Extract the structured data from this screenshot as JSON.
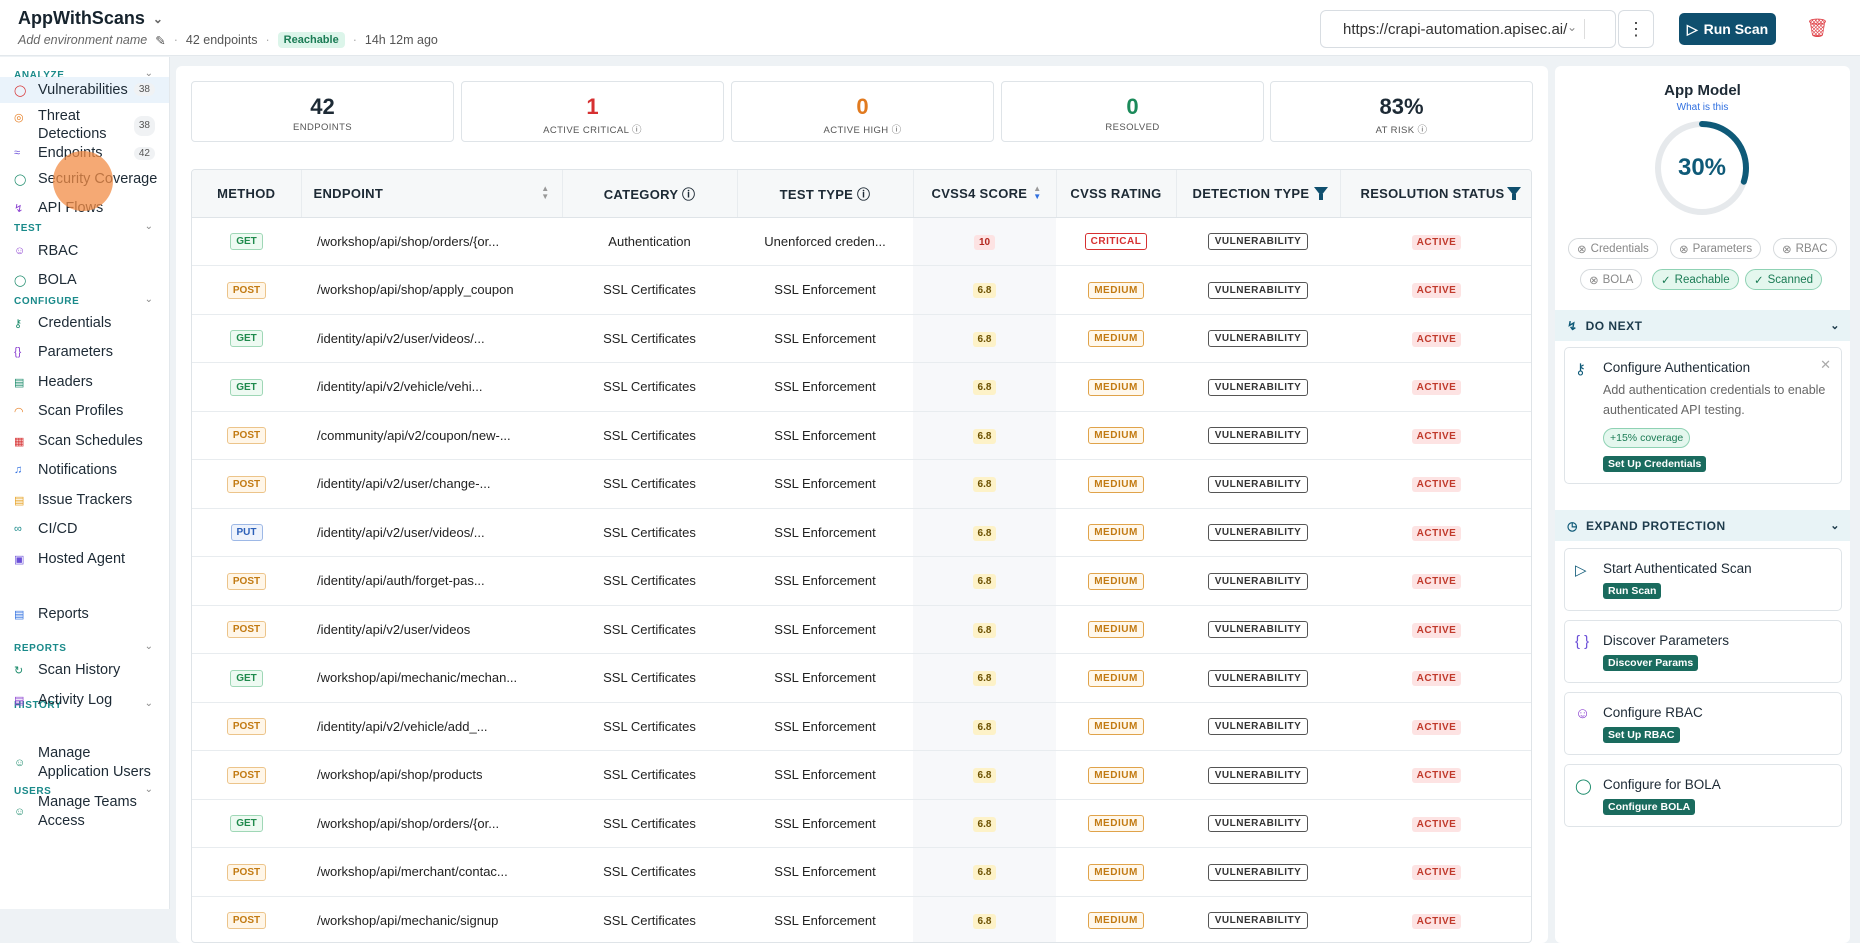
{
  "header": {
    "app_name": "AppWithScans",
    "env_placeholder": "Add environment name",
    "endpoints_count": "42 endpoints",
    "status_badge": "Reachable",
    "last_scan": "14h 12m ago",
    "url": "https://crapi-automation.apisec.ai/",
    "run_scan_label": "Run Scan"
  },
  "sidebar": {
    "sections": [
      {
        "title": "ANALYZE"
      },
      {
        "title": "TEST"
      },
      {
        "title": "CONFIGURE"
      },
      {
        "title": "REPORTS"
      },
      {
        "title": "HISTORY"
      },
      {
        "title": "USERS"
      }
    ],
    "items": [
      {
        "label": "Vulnerabilities",
        "count": "38"
      },
      {
        "label": "Threat Detections",
        "count": "38"
      },
      {
        "label": "Endpoints",
        "count": "42"
      },
      {
        "label": "Security Coverage"
      },
      {
        "label": "API Flows"
      },
      {
        "label": "RBAC"
      },
      {
        "label": "BOLA"
      },
      {
        "label": "Credentials"
      },
      {
        "label": "Parameters"
      },
      {
        "label": "Headers"
      },
      {
        "label": "Scan Profiles"
      },
      {
        "label": "Scan Schedules"
      },
      {
        "label": "Notifications"
      },
      {
        "label": "Issue Trackers"
      },
      {
        "label": "CI/CD"
      },
      {
        "label": "Hosted Agent"
      },
      {
        "label": "Reports"
      },
      {
        "label": "Scan History"
      },
      {
        "label": "Activity Log"
      },
      {
        "label": "Manage Application Users"
      },
      {
        "label": "Manage Teams Access"
      }
    ]
  },
  "stats": [
    {
      "value": "42",
      "label": "ENDPOINTS",
      "color": "#1d2a35"
    },
    {
      "value": "1",
      "label": "ACTIVE CRITICAL ⓘ",
      "color": "#d63031"
    },
    {
      "value": "0",
      "label": "ACTIVE HIGH ⓘ",
      "color": "#e17a1f"
    },
    {
      "value": "0",
      "label": "RESOLVED",
      "color": "#1b8a5a"
    },
    {
      "value": "83%",
      "label": "AT RISK ⓘ",
      "color": "#1d2a35"
    }
  ],
  "table": {
    "columns": [
      "METHOD",
      "ENDPOINT",
      "CATEGORY ⓘ",
      "TEST TYPE ⓘ",
      "CVSS4 SCORE",
      "CVSS RATING",
      "DETECTION TYPE",
      "RESOLUTION STATUS"
    ],
    "rows": [
      {
        "method": "GET",
        "endpoint": "/workshop/api/shop/orders/{or...",
        "category": "Authentication",
        "test_type": "Unenforced creden...",
        "score": "10",
        "rating": "CRITICAL",
        "detection": "VULNERABILITY",
        "status": "ACTIVE"
      },
      {
        "method": "POST",
        "endpoint": "/workshop/api/shop/apply_coupon",
        "category": "SSL Certificates",
        "test_type": "SSL Enforcement",
        "score": "6.8",
        "rating": "MEDIUM",
        "detection": "VULNERABILITY",
        "status": "ACTIVE"
      },
      {
        "method": "GET",
        "endpoint": "/identity/api/v2/user/videos/...",
        "category": "SSL Certificates",
        "test_type": "SSL Enforcement",
        "score": "6.8",
        "rating": "MEDIUM",
        "detection": "VULNERABILITY",
        "status": "ACTIVE"
      },
      {
        "method": "GET",
        "endpoint": "/identity/api/v2/vehicle/vehi...",
        "category": "SSL Certificates",
        "test_type": "SSL Enforcement",
        "score": "6.8",
        "rating": "MEDIUM",
        "detection": "VULNERABILITY",
        "status": "ACTIVE"
      },
      {
        "method": "POST",
        "endpoint": "/community/api/v2/coupon/new-...",
        "category": "SSL Certificates",
        "test_type": "SSL Enforcement",
        "score": "6.8",
        "rating": "MEDIUM",
        "detection": "VULNERABILITY",
        "status": "ACTIVE"
      },
      {
        "method": "POST",
        "endpoint": "/identity/api/v2/user/change-...",
        "category": "SSL Certificates",
        "test_type": "SSL Enforcement",
        "score": "6.8",
        "rating": "MEDIUM",
        "detection": "VULNERABILITY",
        "status": "ACTIVE"
      },
      {
        "method": "PUT",
        "endpoint": "/identity/api/v2/user/videos/...",
        "category": "SSL Certificates",
        "test_type": "SSL Enforcement",
        "score": "6.8",
        "rating": "MEDIUM",
        "detection": "VULNERABILITY",
        "status": "ACTIVE"
      },
      {
        "method": "POST",
        "endpoint": "/identity/api/auth/forget-pas...",
        "category": "SSL Certificates",
        "test_type": "SSL Enforcement",
        "score": "6.8",
        "rating": "MEDIUM",
        "detection": "VULNERABILITY",
        "status": "ACTIVE"
      },
      {
        "method": "POST",
        "endpoint": "/identity/api/v2/user/videos",
        "category": "SSL Certificates",
        "test_type": "SSL Enforcement",
        "score": "6.8",
        "rating": "MEDIUM",
        "detection": "VULNERABILITY",
        "status": "ACTIVE"
      },
      {
        "method": "GET",
        "endpoint": "/workshop/api/mechanic/mechan...",
        "category": "SSL Certificates",
        "test_type": "SSL Enforcement",
        "score": "6.8",
        "rating": "MEDIUM",
        "detection": "VULNERABILITY",
        "status": "ACTIVE"
      },
      {
        "method": "POST",
        "endpoint": "/identity/api/v2/vehicle/add_...",
        "category": "SSL Certificates",
        "test_type": "SSL Enforcement",
        "score": "6.8",
        "rating": "MEDIUM",
        "detection": "VULNERABILITY",
        "status": "ACTIVE"
      },
      {
        "method": "POST",
        "endpoint": "/workshop/api/shop/products",
        "category": "SSL Certificates",
        "test_type": "SSL Enforcement",
        "score": "6.8",
        "rating": "MEDIUM",
        "detection": "VULNERABILITY",
        "status": "ACTIVE"
      },
      {
        "method": "GET",
        "endpoint": "/workshop/api/shop/orders/{or...",
        "category": "SSL Certificates",
        "test_type": "SSL Enforcement",
        "score": "6.8",
        "rating": "MEDIUM",
        "detection": "VULNERABILITY",
        "status": "ACTIVE"
      },
      {
        "method": "POST",
        "endpoint": "/workshop/api/merchant/contac...",
        "category": "SSL Certificates",
        "test_type": "SSL Enforcement",
        "score": "6.8",
        "rating": "MEDIUM",
        "detection": "VULNERABILITY",
        "status": "ACTIVE"
      },
      {
        "method": "POST",
        "endpoint": "/workshop/api/mechanic/signup",
        "category": "SSL Certificates",
        "test_type": "SSL Enforcement",
        "score": "6.8",
        "rating": "MEDIUM",
        "detection": "VULNERABILITY",
        "status": "ACTIVE"
      }
    ]
  },
  "app_model": {
    "title": "App Model",
    "link": "What is this",
    "percent_label": "30%",
    "percent_value": 0.3,
    "chips": [
      {
        "label": "Credentials",
        "state": "off"
      },
      {
        "label": "Parameters",
        "state": "off"
      },
      {
        "label": "RBAC",
        "state": "off"
      },
      {
        "label": "BOLA",
        "state": "off"
      },
      {
        "label": "Reachable",
        "state": "on"
      },
      {
        "label": "Scanned",
        "state": "on"
      }
    ],
    "do_next_title": "DO NEXT",
    "do_next_card": {
      "title": "Configure Authentication",
      "desc": "Add authentication credentials to enable authenticated API testing.",
      "coverage": "+15% coverage",
      "button": "Set Up Credentials"
    },
    "expand_title": "EXPAND PROTECTION",
    "expand_cards": [
      {
        "title": "Start Authenticated Scan",
        "button": "Run Scan",
        "icon": "play-icon"
      },
      {
        "title": "Discover Parameters",
        "button": "Discover Params",
        "icon": "braces-icon"
      },
      {
        "title": "Configure RBAC",
        "button": "Set Up RBAC",
        "icon": "users-icon"
      },
      {
        "title": "Configure for BOLA",
        "button": "Configure BOLA",
        "icon": "shield-icon"
      }
    ]
  }
}
